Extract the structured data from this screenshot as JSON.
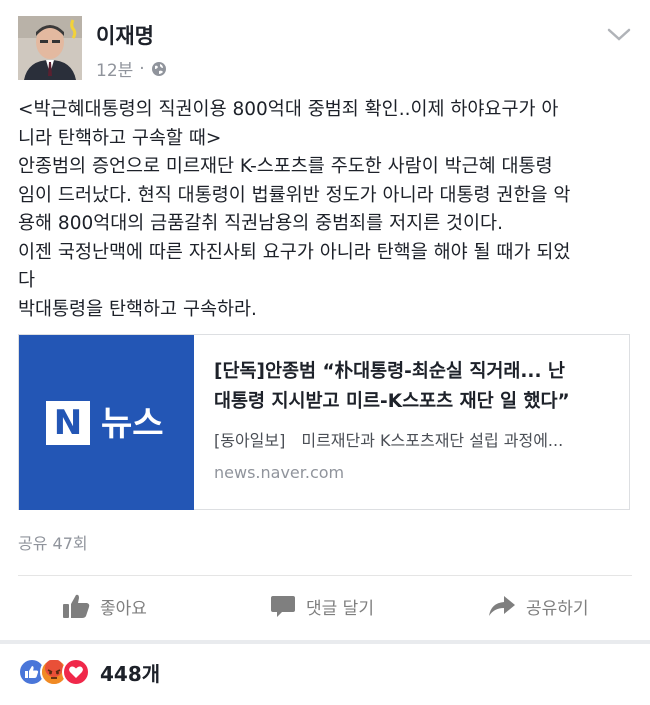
{
  "post": {
    "author": "이재명",
    "time": "12분",
    "dot": "·",
    "privacy_icon": "globe-icon",
    "menu_icon": "chevron-down-icon",
    "body_lines": [
      "<박근혜대통령의 직권이용 800억대 중범죄 확인..이제 하야요구가 아",
      "니라 탄핵하고 구속할 때>",
      "안종범의 증언으로 미르재단 K-스포츠를 주도한 사람이 박근혜 대통령",
      "임이 드러났다. 현직 대통령이 법률위반 정도가 아니라 대통령 권한을 악",
      "용해 800억대의 금품갈취 직권남용의 중범죄를 저지른 것이다.",
      "이젠 국정난맥에 따른 자진사퇴 요구가 아니라 탄핵을 해야 될 때가 되었",
      "다",
      "박대통령을 탄핵하고 구속하라."
    ]
  },
  "link_card": {
    "thumb_logo_letter": "N",
    "thumb_word": "뉴스",
    "title_lines": [
      "[단독]안종범 “朴대통령-최순실 직거래... 난",
      "대통령 지시받고 미르-K스포츠 재단 일 했다”"
    ],
    "description": "[동아일보]　미르재단과 K스포츠재단 설립 과정에...",
    "domain": "news.naver.com"
  },
  "shares": "공유 47회",
  "actions": {
    "like": "좋아요",
    "comment": "댓글 달기",
    "share": "공유하기"
  },
  "reactions": {
    "icons": [
      "like-reaction-icon",
      "angry-reaction-icon",
      "love-reaction-icon"
    ],
    "count": "448개"
  },
  "colors": {
    "link_thumb_bg": "#2356b5",
    "like_blue": "#4a76d9",
    "angry_orange": "#f08a24",
    "love_red": "#f0284a",
    "meta_gray": "#90949c"
  }
}
